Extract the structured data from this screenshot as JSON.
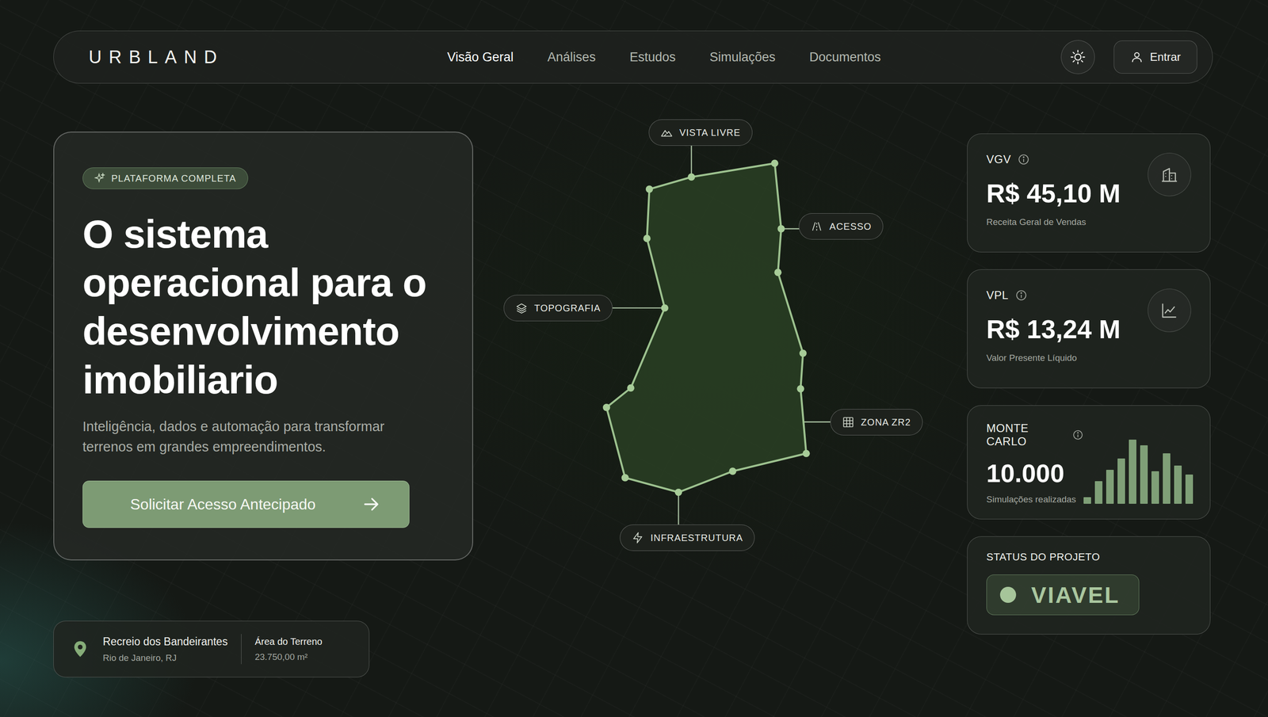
{
  "brand": {
    "logo": "URBLAND"
  },
  "nav": {
    "items": [
      {
        "label": "Visão Geral",
        "selected": true
      },
      {
        "label": "Análises",
        "selected": false
      },
      {
        "label": "Estudos",
        "selected": false
      },
      {
        "label": "Simulações",
        "selected": false
      },
      {
        "label": "Documentos",
        "selected": false
      }
    ],
    "login": "Entrar"
  },
  "hero": {
    "badge": "PLATAFORMA COMPLETA",
    "title": "O sistema operacional para o desenvolvimento imobiliario",
    "subtitle": "Inteligência, dados e automação para transformar terrenos em grandes empreendimentos.",
    "cta": "Solicitar Acesso Antecipado"
  },
  "location": {
    "name": "Recreio dos Bandeirantes",
    "city": "Rio de Janeiro, RJ",
    "area_label": "Área do Terreno",
    "area": "23.750,00 m²"
  },
  "map": {
    "labels": [
      "VISTA LIVRE",
      "ACESSO",
      "TOPOGRAFIA",
      "ZONA ZR2",
      "INFRAESTRUTURA"
    ]
  },
  "metrics": [
    {
      "label": "VGV",
      "value": "R$ 45,10 M",
      "caption": "Receita Geral de Vendas"
    },
    {
      "label": "VPL",
      "value": "R$ 13,24 M",
      "caption": "Valor Presente Líquido"
    }
  ],
  "simulation": {
    "label": "MONTE CARLO",
    "value": "10.000",
    "caption": "Simulações realizadas",
    "bars": [
      8,
      28,
      42,
      56,
      79,
      72,
      40,
      62,
      47,
      36
    ]
  },
  "status": {
    "label": "STATUS DO PROJETO",
    "value": "VIAVEL"
  }
}
